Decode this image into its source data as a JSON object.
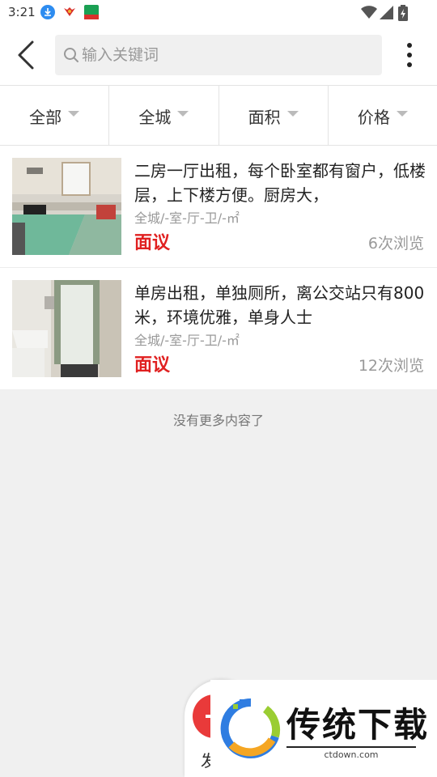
{
  "status_bar": {
    "time": "3:21",
    "icons_left": [
      "download-icon",
      "app-icon",
      "app-icon-2"
    ],
    "icons_right": [
      "wifi-icon",
      "signal-icon",
      "battery-icon"
    ]
  },
  "header": {
    "back_icon": "chevron-left-icon",
    "search": {
      "placeholder": "输入关键词",
      "value": "",
      "icon": "search-icon"
    },
    "more_icon": "more-vertical-icon"
  },
  "filters": [
    {
      "label": "全部"
    },
    {
      "label": "全城"
    },
    {
      "label": "面积"
    },
    {
      "label": "价格"
    }
  ],
  "listings": [
    {
      "title": "二房一厅出租，每个卧室都有窗户，低楼层，上下楼方便。厨房大，",
      "meta": "全城/-室-厅-卫/-㎡",
      "price": "面议",
      "views": "6次浏览"
    },
    {
      "title": "单房出租，单独厕所，离公交站只有800米，环境优雅，单身人士",
      "meta": "全城/-室-厅-卫/-㎡",
      "price": "面议",
      "views": "12次浏览"
    }
  ],
  "no_more_text": "没有更多内容了",
  "fab": {
    "label": "发"
  },
  "watermark": {
    "title": "传统下载",
    "url": "ctdown.com"
  },
  "colors": {
    "accent": "#e02020",
    "fab": "#e93a3a",
    "background": "#f0f0f0"
  }
}
